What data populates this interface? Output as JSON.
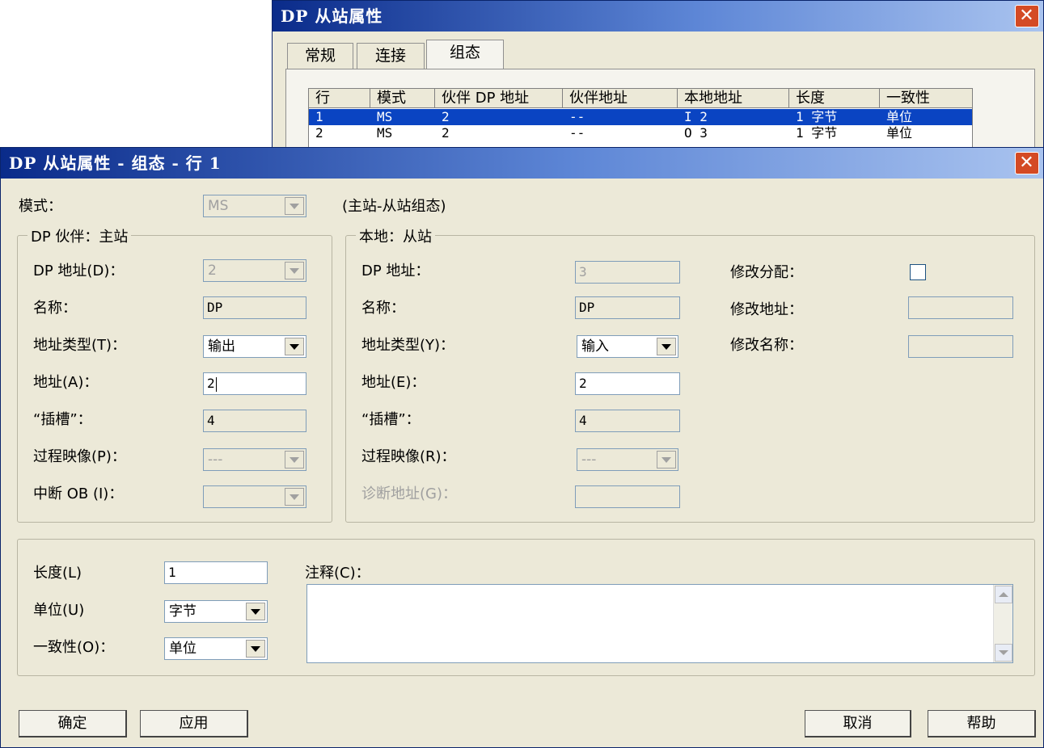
{
  "back_window": {
    "title": "DP 从站属性",
    "tabs": [
      {
        "label": "常规"
      },
      {
        "label": "连接"
      },
      {
        "label": "组态"
      }
    ],
    "table": {
      "headers": [
        "行",
        "模式",
        "伙伴 DP 地址",
        "伙伴地址",
        "本地地址",
        "长度",
        "一致性"
      ],
      "rows": [
        [
          "1",
          "MS",
          "2",
          "--",
          "I 2",
          "1 字节",
          "单位"
        ],
        [
          "2",
          "MS",
          "2",
          "--",
          "O 3",
          "1 字节",
          "单位"
        ]
      ]
    }
  },
  "dialog": {
    "title": "DP 从站属性 - 组态 - 行 1",
    "mode": {
      "label": "模式：",
      "value": "MS",
      "note": "(主站-从站组态)"
    },
    "partner": {
      "legend": "DP 伙伴：主站",
      "dp_address": {
        "label": "DP 地址(D)：",
        "value": "2"
      },
      "name": {
        "label": "名称：",
        "value": "DP"
      },
      "address_type": {
        "label": "地址类型(T)：",
        "value": "输出"
      },
      "address": {
        "label": "地址(A)：",
        "value": "2"
      },
      "slot": {
        "label": "“插槽”：",
        "value": "4"
      },
      "process_image": {
        "label": "过程映像(P)：",
        "value": "---"
      },
      "interrupt_ob": {
        "label": "中断 OB (I)：",
        "value": ""
      }
    },
    "local": {
      "legend": "本地：从站",
      "dp_address": {
        "label": "DP 地址：",
        "value": "3"
      },
      "name": {
        "label": "名称：",
        "value": "DP"
      },
      "address_type": {
        "label": "地址类型(Y)：",
        "value": "输入"
      },
      "address": {
        "label": "地址(E)：",
        "value": "2"
      },
      "slot": {
        "label": "“插槽”：",
        "value": "4"
      },
      "process_image": {
        "label": "过程映像(R)：",
        "value": "---"
      },
      "diag_address": {
        "label": "诊断地址(G)：",
        "value": ""
      },
      "modify_assignment": {
        "label": "修改分配："
      },
      "modify_address": {
        "label": "修改地址：",
        "value": ""
      },
      "modify_name": {
        "label": "修改名称：",
        "value": ""
      }
    },
    "bottom": {
      "length": {
        "label": "长度(L)",
        "value": "1"
      },
      "unit": {
        "label": "单位(U)",
        "value": "字节"
      },
      "consistency": {
        "label": "一致性(O)：",
        "value": "单位"
      },
      "comment": {
        "label": "注释(C)：",
        "value": ""
      }
    },
    "buttons": {
      "ok": "确定",
      "apply": "应用",
      "cancel": "取消",
      "help": "帮助"
    }
  }
}
